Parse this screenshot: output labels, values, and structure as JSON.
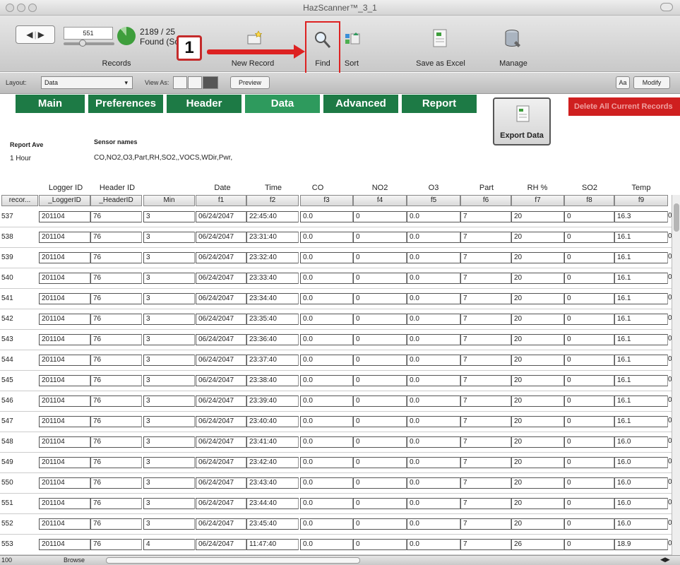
{
  "window": {
    "title": "HazScanner™_3_1"
  },
  "toolbar": {
    "record_value": "551",
    "found_line1": "2189 / 25",
    "found_line2": "Found (So",
    "records_label": "Records",
    "new_record_label": "New Record",
    "find_label": "Find",
    "sort_label": "Sort",
    "save_excel_label": "Save as Excel",
    "manage_label": "Manage"
  },
  "annotation": {
    "step_number": "1",
    "color": "#d22222"
  },
  "layoutbar": {
    "layout_label": "Layout:",
    "layout_value": "Data",
    "view_as_label": "View As:",
    "preview_label": "Preview",
    "aa_label": "Aa",
    "modify_label": "Modify"
  },
  "tabs": [
    {
      "label": "Main"
    },
    {
      "label": "Preferences"
    },
    {
      "label": "Header"
    },
    {
      "label": "Data"
    },
    {
      "label": "Advanced"
    },
    {
      "label": "Report"
    }
  ],
  "colors": {
    "tab": "#1d7a45",
    "tab_active": "#2e9a5d",
    "danger": "#cf1f1f"
  },
  "danger_button_label": "Delete All Current Records",
  "export_button_label": "Export Data",
  "report": {
    "report_ave_label": "Report Ave",
    "report_ave_value": "1 Hour",
    "sensor_names_label": "Sensor names",
    "sensor_names_value": "CO,NO2,O3,Part,RH,SO2,,VOCS,WDir,Pwr,"
  },
  "table": {
    "column_titles": [
      "Logger ID",
      "Header ID",
      "Date",
      "Time",
      "CO",
      "NO2",
      "O3",
      "Part",
      "RH %",
      "SO2",
      "Temp"
    ],
    "field_headers": [
      "recor...",
      "_LoggerID",
      "_HeaderID",
      "Min",
      "f1",
      "f2",
      "f3",
      "f4",
      "f5",
      "f6",
      "f7",
      "f8",
      "f9"
    ],
    "rows": [
      [
        "537",
        "201104",
        "76",
        "3",
        "06/24/2047",
        "22:45:40",
        "0.0",
        "0",
        "0.0",
        "7",
        "20",
        "0",
        "16.3",
        "0"
      ],
      [
        "538",
        "201104",
        "76",
        "3",
        "06/24/2047",
        "23:31:40",
        "0.0",
        "0",
        "0.0",
        "7",
        "20",
        "0",
        "16.1",
        "0"
      ],
      [
        "539",
        "201104",
        "76",
        "3",
        "06/24/2047",
        "23:32:40",
        "0.0",
        "0",
        "0.0",
        "7",
        "20",
        "0",
        "16.1",
        "0"
      ],
      [
        "540",
        "201104",
        "76",
        "3",
        "06/24/2047",
        "23:33:40",
        "0.0",
        "0",
        "0.0",
        "7",
        "20",
        "0",
        "16.1",
        "0"
      ],
      [
        "541",
        "201104",
        "76",
        "3",
        "06/24/2047",
        "23:34:40",
        "0.0",
        "0",
        "0.0",
        "7",
        "20",
        "0",
        "16.1",
        "0"
      ],
      [
        "542",
        "201104",
        "76",
        "3",
        "06/24/2047",
        "23:35:40",
        "0.0",
        "0",
        "0.0",
        "7",
        "20",
        "0",
        "16.1",
        "0"
      ],
      [
        "543",
        "201104",
        "76",
        "3",
        "06/24/2047",
        "23:36:40",
        "0.0",
        "0",
        "0.0",
        "7",
        "20",
        "0",
        "16.1",
        "0"
      ],
      [
        "544",
        "201104",
        "76",
        "3",
        "06/24/2047",
        "23:37:40",
        "0.0",
        "0",
        "0.0",
        "7",
        "20",
        "0",
        "16.1",
        "0"
      ],
      [
        "545",
        "201104",
        "76",
        "3",
        "06/24/2047",
        "23:38:40",
        "0.0",
        "0",
        "0.0",
        "7",
        "20",
        "0",
        "16.1",
        "0"
      ],
      [
        "546",
        "201104",
        "76",
        "3",
        "06/24/2047",
        "23:39:40",
        "0.0",
        "0",
        "0.0",
        "7",
        "20",
        "0",
        "16.1",
        "0"
      ],
      [
        "547",
        "201104",
        "76",
        "3",
        "06/24/2047",
        "23:40:40",
        "0.0",
        "0",
        "0.0",
        "7",
        "20",
        "0",
        "16.1",
        "0"
      ],
      [
        "548",
        "201104",
        "76",
        "3",
        "06/24/2047",
        "23:41:40",
        "0.0",
        "0",
        "0.0",
        "7",
        "20",
        "0",
        "16.0",
        "0"
      ],
      [
        "549",
        "201104",
        "76",
        "3",
        "06/24/2047",
        "23:42:40",
        "0.0",
        "0",
        "0.0",
        "7",
        "20",
        "0",
        "16.0",
        "0"
      ],
      [
        "550",
        "201104",
        "76",
        "3",
        "06/24/2047",
        "23:43:40",
        "0.0",
        "0",
        "0.0",
        "7",
        "20",
        "0",
        "16.0",
        "0"
      ],
      [
        "551",
        "201104",
        "76",
        "3",
        "06/24/2047",
        "23:44:40",
        "0.0",
        "0",
        "0.0",
        "7",
        "20",
        "0",
        "16.0",
        "0"
      ],
      [
        "552",
        "201104",
        "76",
        "3",
        "06/24/2047",
        "23:45:40",
        "0.0",
        "0",
        "0.0",
        "7",
        "20",
        "0",
        "16.0",
        "0"
      ],
      [
        "553",
        "201104",
        "76",
        "4",
        "06/24/2047",
        "11:47:40",
        "0.0",
        "0",
        "0.0",
        "7",
        "26",
        "0",
        "18.9",
        "0"
      ]
    ]
  },
  "statusbar": {
    "zoom": "100",
    "mode": "Browse"
  }
}
